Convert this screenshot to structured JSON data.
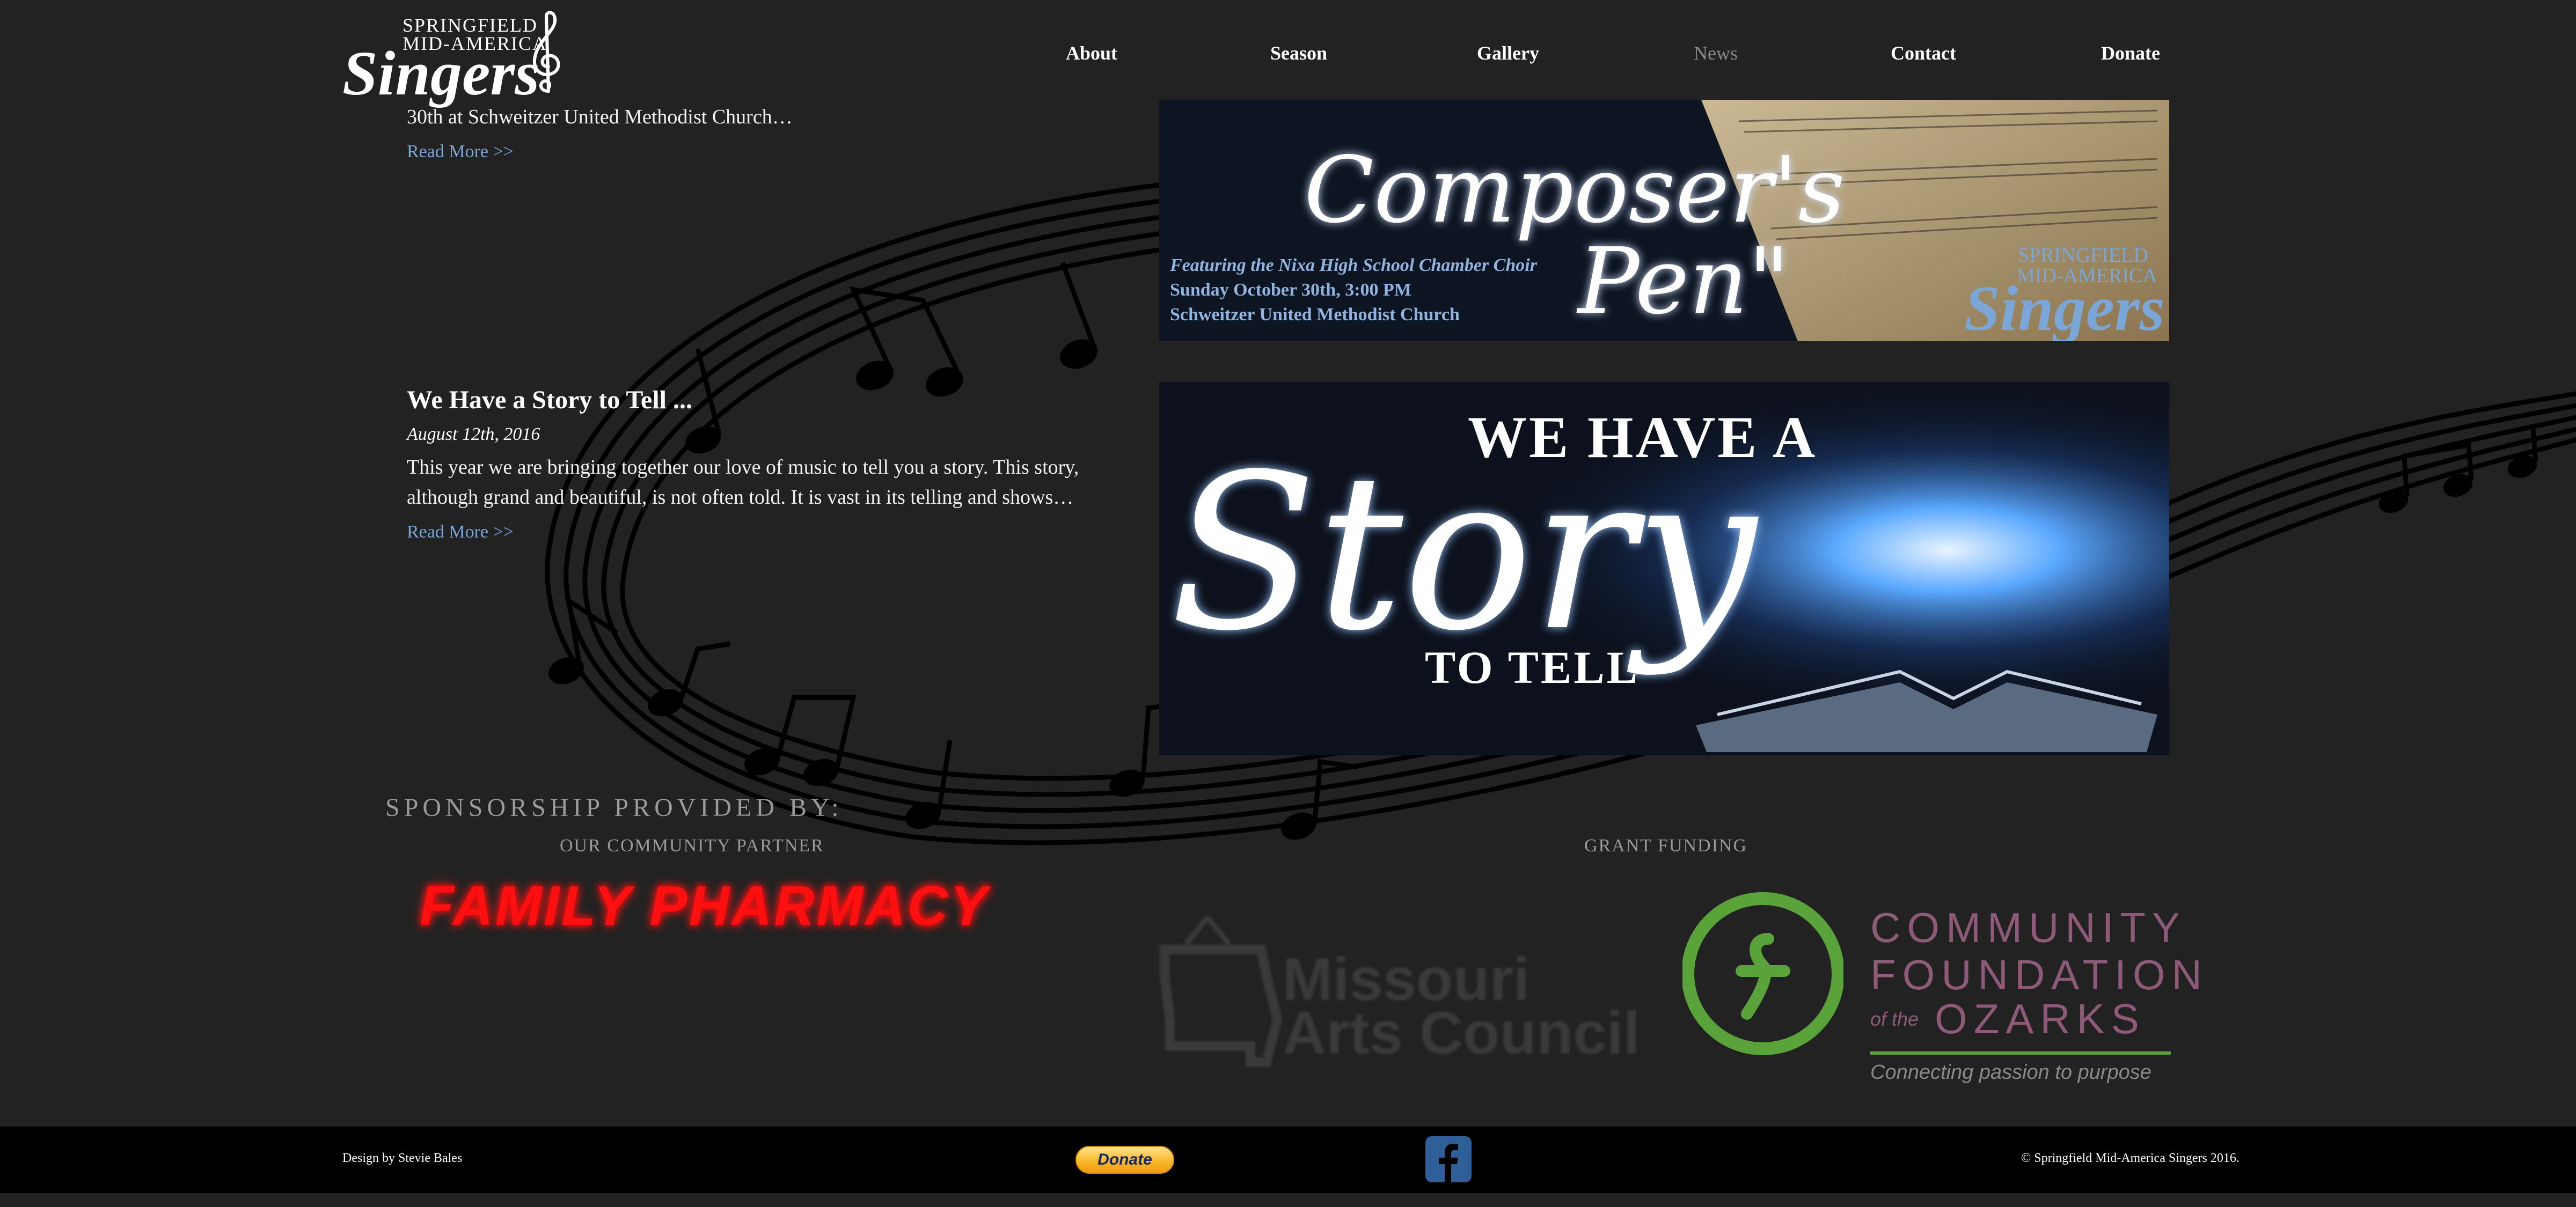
{
  "brand": {
    "line1": "SPRINGFIELD",
    "line2": "MID-AMERICA",
    "line3": "Singers"
  },
  "nav": [
    {
      "label": "About",
      "current": false
    },
    {
      "label": "Season",
      "current": false
    },
    {
      "label": "Gallery",
      "current": false
    },
    {
      "label": "News",
      "current": true
    },
    {
      "label": "Contact",
      "current": false
    },
    {
      "label": "Donate",
      "current": false
    }
  ],
  "posts": [
    {
      "excerpt": "30th at Schweitzer United Methodist Church…",
      "read_more": "Read More >>",
      "banner": {
        "title_a": "Composer's",
        "title_b": "Pen\"",
        "line1": "Featuring the Nixa High School Chamber Choir",
        "line2": "Sunday October 30th, 3:00 PM",
        "line3": "Schweitzer United Methodist Church",
        "brand_1": "SPRINGFIELD",
        "brand_2": "MID-AMERICA",
        "brand_3": "Singers"
      }
    },
    {
      "title": "We Have a Story to Tell ...",
      "date": "August 12th, 2016",
      "excerpt_line1": "This year we are bringing together our love of music to tell you a story. This story,",
      "excerpt_line2": "although grand and beautiful, is not often told. It is vast in its telling and shows…",
      "read_more": "Read More >>",
      "banner": {
        "top": "WE HAVE A",
        "main": "Story",
        "bottom": "TO TELL"
      }
    }
  ],
  "sponsorship": {
    "heading": "SPONSORSHIP PROVIDED BY:",
    "partner_label": "OUR COMMUNITY PARTNER",
    "grant_label": "GRANT FUNDING",
    "partner_name": "FAMILY PHARMACY",
    "mac_line1": "Missouri",
    "mac_line2": "Arts Council",
    "cfo_line1": "COMMUNITY",
    "cfo_line2": "FOUNDATION",
    "cfo_of": "of the",
    "cfo_line3": "OZARKS",
    "cfo_tagline": "Connecting passion to purpose"
  },
  "footer": {
    "credit": "Design by Stevie Bales",
    "donate_label": "Donate",
    "copyright": "© Springfield Mid-America Singers 2016."
  },
  "colors": {
    "background": "#222222",
    "link": "#7aa6d8",
    "footer": "#000000",
    "pharmacy_red": "#ff1010",
    "facebook_blue": "#2f5f99"
  },
  "icons": [
    "treble-clef-icon",
    "facebook-icon",
    "music-staff-decoration"
  ]
}
